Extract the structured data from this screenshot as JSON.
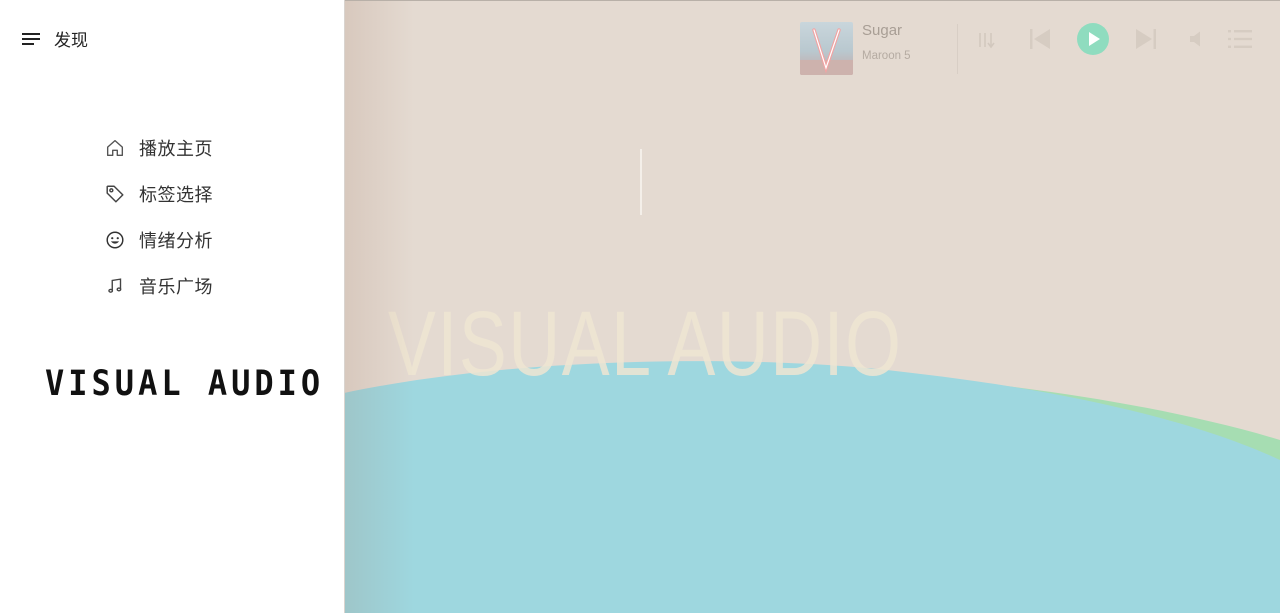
{
  "sidebar": {
    "menu_label": "发现",
    "nav": [
      {
        "label": "播放主页",
        "icon": "home-icon"
      },
      {
        "label": "标签选择",
        "icon": "tag-icon"
      },
      {
        "label": "情绪分析",
        "icon": "smiley-icon"
      },
      {
        "label": "音乐广场",
        "icon": "music-note-icon"
      }
    ],
    "brand": "VISUAL AUDIO"
  },
  "hero": {
    "title": "VISUAL  AUDIO"
  },
  "player": {
    "track_title": "Sugar",
    "track_artist": "Maroon 5",
    "controls": [
      "sort-order-icon",
      "previous-icon",
      "play-icon",
      "next-icon",
      "volume-icon",
      "playlist-icon"
    ]
  },
  "colors": {
    "background": "#e4dad1",
    "wave_blue": "#9ed7df",
    "wave_green": "#a6ddb2",
    "play_accent": "#8fdcbf",
    "hero_text": "#efe6d3"
  }
}
